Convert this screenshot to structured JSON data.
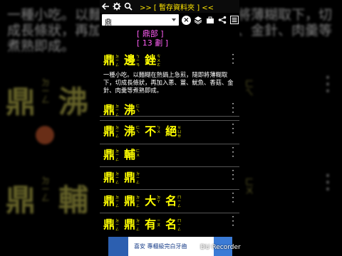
{
  "background": {
    "text": "一種小吃。以麵糊在熱鍋上急煎，隨即將薄糊取下，切成長條狀，再加入蔥、薑、魷魚、香菇、金針、肉羹等煮熟即成。",
    "words": [
      "鼎",
      "沸",
      "鼎",
      "輔"
    ],
    "zhuyin": [
      "ㄉ\nㄧ\nㄥ",
      "ㄈ\nㄟ",
      "ㄉ\nㄧ\nㄥ",
      "ㄈ\nㄨ"
    ]
  },
  "toolbar": {
    "back_icon": "arrow-left-icon",
    "settings_icon": "gear-icon",
    "search_icon": "search-icon",
    "title": ">> [ 暫存資料夾 ] <<",
    "forward_icon": "arrow-right-icon"
  },
  "search": {
    "value": "鼎",
    "clear_icon": "clear-icon",
    "layers_icon": "layers-icon",
    "briefcase_icon": "briefcase-icon",
    "share_icon": "share-icon",
    "menu_icon": "menu-icon"
  },
  "radical": {
    "name": "[ 鼎部 ]",
    "strokes": "[ 13 劃 ]"
  },
  "entries": [
    {
      "chars": [
        {
          "hz": "鼎",
          "zy": "ㄉ\nㄧ\nㄥ"
        },
        {
          "hz": "邊",
          "zy": "ㄅ\nㄧ\nㄢ"
        },
        {
          "hz": "銼",
          "zy": "ㄘ\nㄨ\nㄛ"
        }
      ]
    },
    {
      "chars": [
        {
          "hz": "鼎",
          "zy": "ㄉ\nㄧ\nㄥ"
        },
        {
          "hz": "沸",
          "zy": "ㄈ\nㄟ"
        }
      ]
    },
    {
      "chars": [
        {
          "hz": "鼎",
          "zy": "ㄉ\nㄧ\nㄥ"
        },
        {
          "hz": "沸",
          "zy": "ㄈ\nㄟ"
        },
        {
          "hz": "不",
          "zy": "ㄅ\nㄨ"
        },
        {
          "hz": "絕",
          "zy": "ㄐ\nㄩ\nㄝ"
        }
      ]
    },
    {
      "chars": [
        {
          "hz": "鼎",
          "zy": "ㄉ\nㄧ\nㄥ"
        },
        {
          "hz": "輔",
          "zy": "ㄈ\nㄨ"
        }
      ]
    },
    {
      "chars": [
        {
          "hz": "鼎",
          "zy": "ㄉ\nㄧ\nㄥ"
        },
        {
          "hz": "鼎",
          "zy": "ㄉ\nㄧ\nㄥ"
        }
      ]
    },
    {
      "chars": [
        {
          "hz": "鼎",
          "zy": "ㄉ\nㄧ\nㄥ"
        },
        {
          "hz": "鼎",
          "zy": "ㄉ\nㄧ\nㄥ"
        },
        {
          "hz": "大",
          "zy": "ㄉ\nㄚ"
        },
        {
          "hz": "名",
          "zy": "ㄇ\nㄧ\nㄥ"
        }
      ]
    },
    {
      "chars": [
        {
          "hz": "鼎",
          "zy": "ㄉ\nㄧ\nㄥ"
        },
        {
          "hz": "鼎",
          "zy": "ㄉ\nㄧ\nㄥ"
        },
        {
          "hz": "有",
          "zy": "ㄧ\nㄡ"
        },
        {
          "hz": "名",
          "zy": "ㄇ\nㄧ\nㄥ"
        }
      ]
    }
  ],
  "definition": "一種小吃。以麵糊在熱鍋上急煎，隨即將薄糊取下，切成長條狀，再加入蔥、薑、魷魚、香菇、金針、肉羹等煮熟即成。",
  "ad": {
    "text": "喜安 專櫃級完白牙齒"
  },
  "recorder": {
    "label": "DU Recorder"
  }
}
